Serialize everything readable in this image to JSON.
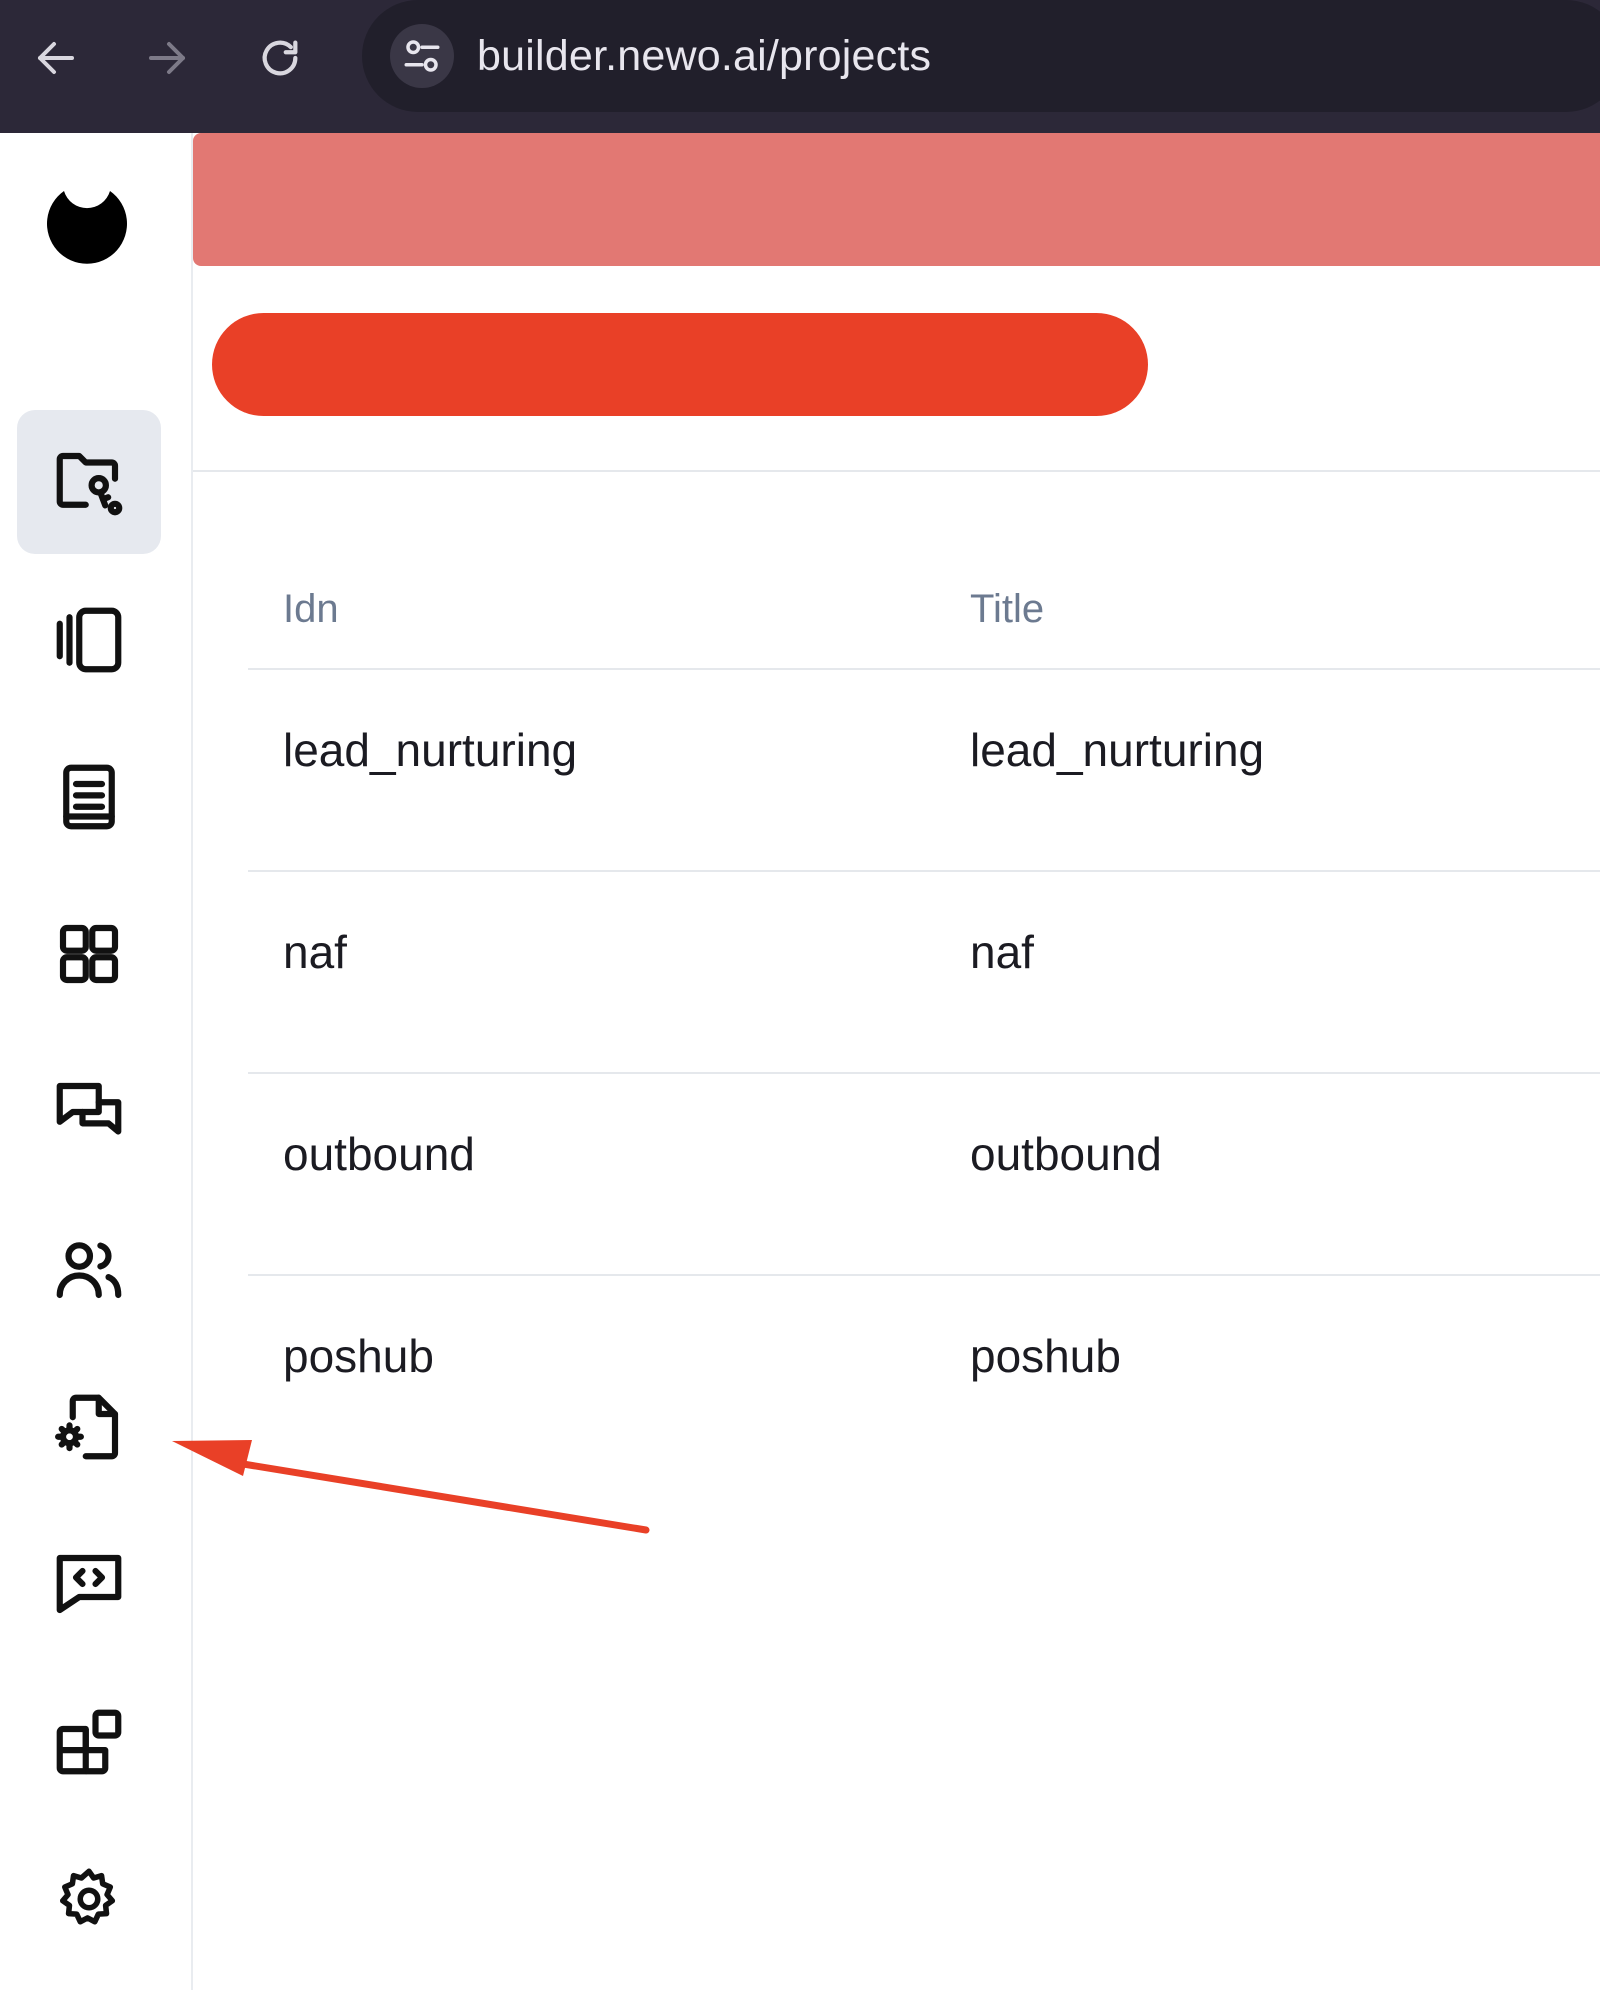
{
  "browser": {
    "url": "builder.newo.ai/projects"
  },
  "sidebar": {
    "items": [
      {
        "name": "projects",
        "icon": "folder-key-icon",
        "active": true
      },
      {
        "name": "flows",
        "icon": "carousel-icon",
        "active": false
      },
      {
        "name": "docs",
        "icon": "book-icon",
        "active": false
      },
      {
        "name": "apps",
        "icon": "grid-icon",
        "active": false
      },
      {
        "name": "chats",
        "icon": "chat-bubbles-icon",
        "active": false
      },
      {
        "name": "users",
        "icon": "users-icon",
        "active": false
      },
      {
        "name": "file-settings",
        "icon": "file-gear-icon",
        "active": false
      },
      {
        "name": "code-chat",
        "icon": "code-message-icon",
        "active": false
      },
      {
        "name": "integrations",
        "icon": "blocks-icon",
        "active": false
      },
      {
        "name": "settings",
        "icon": "gear-icon",
        "active": false
      }
    ]
  },
  "table": {
    "headers": [
      "Idn",
      "Title"
    ],
    "rows": [
      {
        "idn": "lead_nurturing",
        "title": "lead_nurturing"
      },
      {
        "idn": "naf",
        "title": "naf"
      },
      {
        "idn": "outbound",
        "title": "outbound"
      },
      {
        "idn": "poshub",
        "title": "poshub"
      }
    ]
  },
  "colors": {
    "chrome": "#2c2838",
    "banner": "#e27873",
    "redaction": "#e94027",
    "annotation_arrow": "#e94027",
    "active_item_bg": "#e6e9ef",
    "header_text": "#6c7a90"
  }
}
